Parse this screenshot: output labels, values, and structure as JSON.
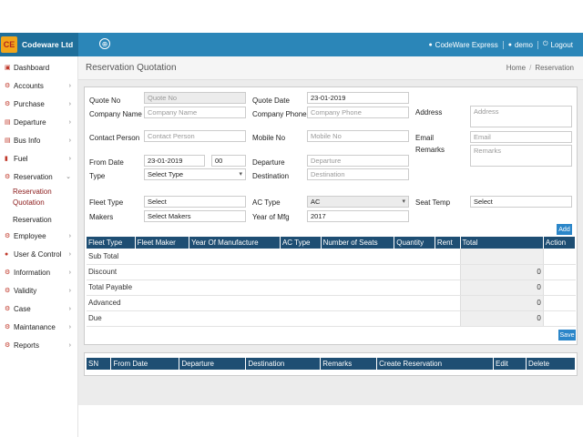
{
  "brand": {
    "logo_text": "CE",
    "name": "Codeware Ltd"
  },
  "topbar": {
    "toggle_icon": "⊕",
    "company": "CodeWare Express",
    "user": "demo",
    "logout": "Logout"
  },
  "sidebar": {
    "items": [
      {
        "label": "Dashboard",
        "icon": "dashboard-icon",
        "glyph": "▣",
        "chevron": ""
      },
      {
        "label": "Accounts",
        "icon": "gear-icon",
        "glyph": "⚙",
        "chevron": "›"
      },
      {
        "label": "Purchase",
        "icon": "gear-icon",
        "glyph": "⚙",
        "chevron": "›"
      },
      {
        "label": "Departure",
        "icon": "bus-icon",
        "glyph": "▤",
        "chevron": "›"
      },
      {
        "label": "Bus Info",
        "icon": "bus-icon",
        "glyph": "▤",
        "chevron": "›"
      },
      {
        "label": "Fuel",
        "icon": "fuel-icon",
        "glyph": "▮",
        "chevron": "›"
      },
      {
        "label": "Reservation",
        "icon": "gear-icon",
        "glyph": "⚙",
        "chevron": "⌄"
      }
    ],
    "sub_items": [
      {
        "label": "Reservation Quotation"
      },
      {
        "label": "Reservation"
      }
    ],
    "items2": [
      {
        "label": "Employee",
        "icon": "gear-icon",
        "glyph": "⚙",
        "chevron": "›"
      },
      {
        "label": "User & Control",
        "icon": "user-icon",
        "glyph": "●",
        "chevron": "›"
      },
      {
        "label": "Information",
        "icon": "gear-icon",
        "glyph": "⚙",
        "chevron": "›"
      },
      {
        "label": "Validity",
        "icon": "gear-icon",
        "glyph": "⚙",
        "chevron": "›"
      },
      {
        "label": "Case",
        "icon": "gear-icon",
        "glyph": "⚙",
        "chevron": "›"
      },
      {
        "label": "Maintanance",
        "icon": "gear-icon",
        "glyph": "⚙",
        "chevron": "›"
      },
      {
        "label": "Reports",
        "icon": "gear-icon",
        "glyph": "⚙",
        "chevron": "›"
      }
    ]
  },
  "page": {
    "title": "Reservation Quotation",
    "breadcrumb": [
      "Home",
      "Reservation"
    ]
  },
  "form": {
    "quote_no": {
      "label": "Quote No",
      "placeholder": "Quote No"
    },
    "company_name": {
      "label": "Company Name",
      "placeholder": "Company Name"
    },
    "quote_date": {
      "label": "Quote Date",
      "value": "23-01-2019"
    },
    "company_phone": {
      "label": "Company Phone",
      "placeholder": "Company Phone"
    },
    "address": {
      "label": "Address",
      "placeholder": "Address"
    },
    "contact_person": {
      "label": "Contact Person",
      "placeholder": "Contact Person"
    },
    "mobile_no": {
      "label": "Mobile No",
      "placeholder": "Mobile No"
    },
    "email": {
      "label": "Email",
      "placeholder": "Email"
    },
    "remarks": {
      "label": "Remarks",
      "placeholder": "Remarks"
    },
    "from_date": {
      "label": "From Date",
      "value": "23-01-2019",
      "hour": "00"
    },
    "type": {
      "label": "Type",
      "value": "Select Type"
    },
    "departure": {
      "label": "Departure",
      "placeholder": "Departure"
    },
    "destination": {
      "label": "Destination",
      "placeholder": "Destination"
    },
    "fleet_type": {
      "label": "Fleet Type",
      "value": "Select"
    },
    "makers": {
      "label": "Makers",
      "value": "Select Makers"
    },
    "ac_type": {
      "label": "AC Type",
      "value": "AC"
    },
    "year_of_mfg": {
      "label": "Year of Mfg",
      "value": "2017"
    },
    "seat_temp": {
      "label": "Seat Temp",
      "value": "Select"
    },
    "add_label": "Add",
    "save_label": "Save"
  },
  "fleet_table": {
    "headers": [
      "Fleet Type",
      "Fleet Maker",
      "Year Of Manufacture",
      "AC Type",
      "Number of Seats",
      "Quantity",
      "Rent",
      "Total",
      "Action"
    ],
    "summary": [
      {
        "label": "Sub Total",
        "value": ""
      },
      {
        "label": "Discount",
        "value": "0"
      },
      {
        "label": "Total Payable",
        "value": "0"
      },
      {
        "label": "Advanced",
        "value": "0"
      },
      {
        "label": "Due",
        "value": "0"
      }
    ]
  },
  "route_table": {
    "headers": [
      "SN",
      "From Date",
      "Departure",
      "Destination",
      "Remarks",
      "Create Reservation",
      "Edit",
      "Delete"
    ]
  },
  "colors": {
    "topbar": "#2b86b8",
    "brand": "#1f6f9b",
    "table_header": "#1e4e73",
    "button": "#2b86c9",
    "icon": "#c0392b"
  }
}
